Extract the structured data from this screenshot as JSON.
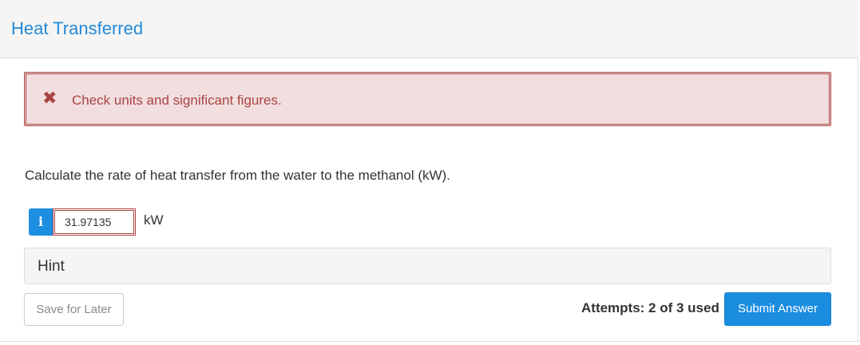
{
  "header": {
    "title": "Heat Transferred"
  },
  "alert": {
    "icon": "close-x-icon",
    "icon_glyph": "✖",
    "message": "Check units and significant figures.",
    "color": "#a94442",
    "background": "#f2dede"
  },
  "question": {
    "text": "Calculate the rate of heat transfer from the water to the methanol (kW)."
  },
  "answer": {
    "info_icon": "info-icon",
    "info_glyph": "i",
    "value": "31.97135",
    "unit": "kW"
  },
  "hint": {
    "label": "Hint"
  },
  "footer": {
    "save_label": "Save for Later",
    "attempts_text": "Attempts: 2 of 3 used",
    "submit_label": "Submit Answer"
  },
  "colors": {
    "accent": "#1a8de0",
    "title": "#2489d6",
    "error": "#a94442"
  }
}
